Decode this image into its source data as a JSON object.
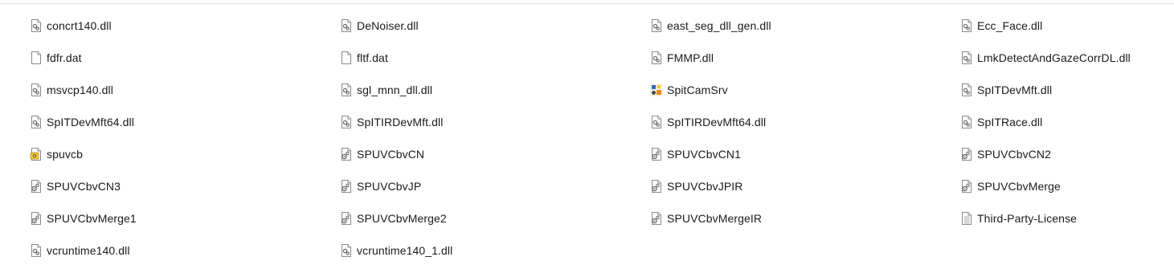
{
  "files": [
    {
      "name": "concrt140.dll",
      "icon": "dll-icon"
    },
    {
      "name": "DeNoiser.dll",
      "icon": "dll-icon"
    },
    {
      "name": "east_seg_dll_gen.dll",
      "icon": "dll-icon"
    },
    {
      "name": "Ecc_Face.dll",
      "icon": "dll-icon"
    },
    {
      "name": "fdfr.dat",
      "icon": "blank-file-icon"
    },
    {
      "name": "fltf.dat",
      "icon": "blank-file-icon"
    },
    {
      "name": "FMMP.dll",
      "icon": "dll-icon"
    },
    {
      "name": "LmkDetectAndGazeCorrDL.dll",
      "icon": "dll-icon"
    },
    {
      "name": "msvcp140.dll",
      "icon": "dll-icon"
    },
    {
      "name": "sgl_mnn_dll.dll",
      "icon": "dll-icon"
    },
    {
      "name": "SpitCamSrv",
      "icon": "app-exe-icon"
    },
    {
      "name": "SpITDevMft.dll",
      "icon": "dll-icon"
    },
    {
      "name": "SpITDevMft64.dll",
      "icon": "dll-icon"
    },
    {
      "name": "SpITIRDevMft.dll",
      "icon": "dll-icon"
    },
    {
      "name": "SpITIRDevMft64.dll",
      "icon": "dll-icon"
    },
    {
      "name": "SpITRace.dll",
      "icon": "dll-icon"
    },
    {
      "name": "spuvcb",
      "icon": "setup-config-icon"
    },
    {
      "name": "SPUVCbvCN",
      "icon": "config-settings-icon"
    },
    {
      "name": "SPUVCbvCN1",
      "icon": "config-settings-icon"
    },
    {
      "name": "SPUVCbvCN2",
      "icon": "config-settings-icon"
    },
    {
      "name": "SPUVCbvCN3",
      "icon": "config-settings-icon"
    },
    {
      "name": "SPUVCbvJP",
      "icon": "config-settings-icon"
    },
    {
      "name": "SPUVCbvJPIR",
      "icon": "config-settings-icon"
    },
    {
      "name": "SPUVCbvMerge",
      "icon": "config-settings-icon"
    },
    {
      "name": "SPUVCbvMerge1",
      "icon": "config-settings-icon"
    },
    {
      "name": "SPUVCbvMerge2",
      "icon": "config-settings-icon"
    },
    {
      "name": "SPUVCbvMergeIR",
      "icon": "config-settings-icon"
    },
    {
      "name": "Third-Party-License",
      "icon": "text-document-icon"
    },
    {
      "name": "vcruntime140.dll",
      "icon": "dll-icon"
    },
    {
      "name": "vcruntime140_1.dll",
      "icon": "dll-icon"
    }
  ],
  "colors": {
    "text": "#1a1a1a",
    "icon_outline": "#8a8a8a",
    "icon_gear": "#6f6f6f",
    "setup_yellow": "#f2c84b",
    "app_orange": "#e8891c",
    "app_blue": "#2a6ebb",
    "divider": "#e3e3e3"
  }
}
